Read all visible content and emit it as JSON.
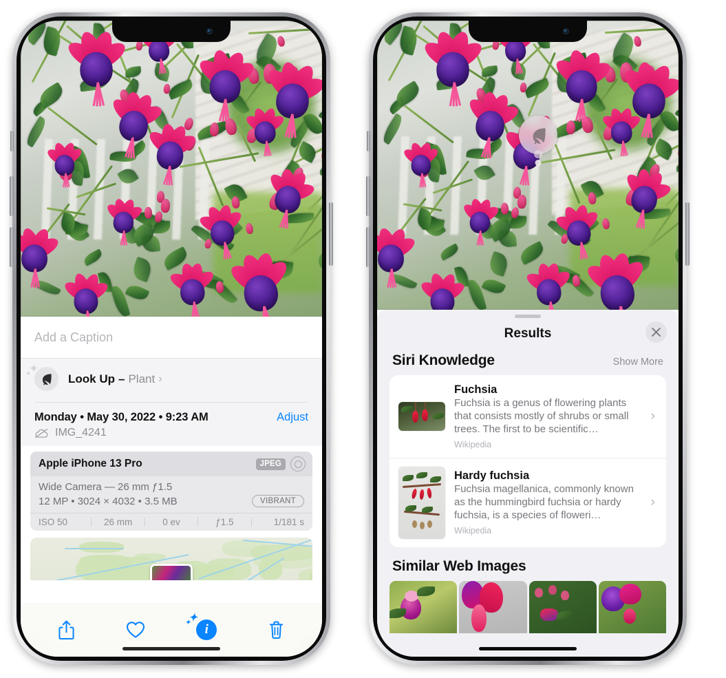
{
  "left_phone": {
    "caption_field": {
      "placeholder": "Add a Caption",
      "value": ""
    },
    "lookup_row": {
      "icon": "leaf-icon",
      "label": "Look Up",
      "dash": "–",
      "subject": "Plant",
      "chevron": "chevron-right-icon"
    },
    "metadata": {
      "date_line": "Monday • May 30, 2022 • 9:23 AM",
      "adjust_label": "Adjust",
      "cloud_icon": "cloud-slash-icon",
      "filename": "IMG_4241"
    },
    "camera_card": {
      "model": "Apple iPhone 13 Pro",
      "format_badge": "JPEG",
      "aperture_icon": "aperture-icon",
      "lens_line": "Wide Camera — 26 mm ƒ1.5",
      "spec_line": "12 MP • 3024 × 4032 • 3.5 MB",
      "style_badge": "VIBRANT",
      "exif": [
        "ISO 50",
        "26 mm",
        "0 ev",
        "ƒ1.5",
        "1/181 s"
      ]
    },
    "map": {
      "pin": "photo-pin"
    },
    "toolbar": [
      {
        "name": "share-icon",
        "label": "Share"
      },
      {
        "name": "favorite-heart-icon",
        "label": "Favorite"
      },
      {
        "name": "info-icon",
        "label": "Info"
      },
      {
        "name": "trash-icon",
        "label": "Delete"
      }
    ]
  },
  "right_phone": {
    "lookup_bubble": {
      "icon": "leaf-icon"
    },
    "sheet": {
      "grabber": "drag-grabber",
      "title": "Results",
      "close_icon": "close-icon"
    },
    "siri_knowledge": {
      "title": "Siri Knowledge",
      "show_more": "Show More",
      "items": [
        {
          "title": "Fuchsia",
          "description": "Fuchsia is a genus of flowering plants that consists mostly of shrubs or small trees. The first to be scientific…",
          "source": "Wikipedia",
          "thumbnail": "red-fuchsia-flowers-photo",
          "chevron": "chevron-right-icon"
        },
        {
          "title": "Hardy fuchsia",
          "description": "Fuchsia magellanica, commonly known as the hummingbird fuchsia or hardy fuchsia, is a species of floweri…",
          "source": "Wikipedia",
          "thumbnail": "hardy-fuchsia-specimen-photo",
          "chevron": "chevron-right-icon"
        }
      ]
    },
    "similar_web_images": {
      "title": "Similar Web Images",
      "items": [
        {
          "alt": "pink-purple-fuchsia-with-leaves"
        },
        {
          "alt": "crimson-fuchsia-closeup"
        },
        {
          "alt": "fuchsia-bush-with-buds"
        },
        {
          "alt": "purple-magenta-fuchsia-cluster"
        }
      ]
    }
  },
  "colors": {
    "accent_blue": "#0a84ff",
    "sheet_gray": "#f1f1f5",
    "card_white": "#ffffff",
    "secondary_text": "#8e8e93"
  }
}
